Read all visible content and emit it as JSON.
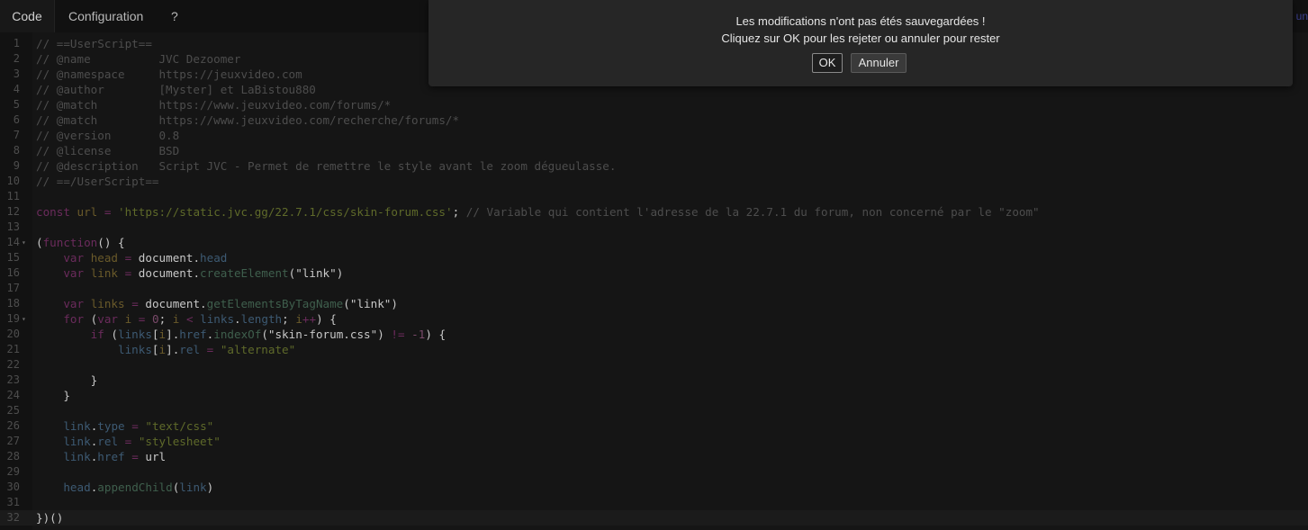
{
  "tabs": {
    "code": "Code",
    "configuration": "Configuration",
    "help": "?",
    "edge_fragment": "un"
  },
  "dialog": {
    "message_line1": "Les modifications n'ont pas étés sauvegardées !",
    "message_line2": "Cliquez sur OK pour les rejeter ou annuler pour rester",
    "ok_label": "OK",
    "cancel_label": "Annuler"
  },
  "editor": {
    "lines": [
      {
        "n": "1",
        "tokens": [
          [
            "cm",
            "// ==UserScript=="
          ]
        ]
      },
      {
        "n": "2",
        "tokens": [
          [
            "cm",
            "// @name          JVC Dezoomer"
          ]
        ]
      },
      {
        "n": "3",
        "tokens": [
          [
            "cm",
            "// @namespace     https://jeuxvideo.com"
          ]
        ]
      },
      {
        "n": "4",
        "tokens": [
          [
            "cm",
            "// @author        [Myster] et LaBistou880"
          ]
        ]
      },
      {
        "n": "5",
        "tokens": [
          [
            "cm",
            "// @match         https://www.jeuxvideo.com/forums/*"
          ]
        ]
      },
      {
        "n": "6",
        "tokens": [
          [
            "cm",
            "// @match         https://www.jeuxvideo.com/recherche/forums/*"
          ]
        ]
      },
      {
        "n": "7",
        "tokens": [
          [
            "cm",
            "// @version       0.8"
          ]
        ]
      },
      {
        "n": "8",
        "tokens": [
          [
            "cm",
            "// @license       BSD"
          ]
        ]
      },
      {
        "n": "9",
        "tokens": [
          [
            "cm",
            "// @description   Script JVC - Permet de remettre le style avant le zoom dégueulasse."
          ]
        ]
      },
      {
        "n": "10",
        "tokens": [
          [
            "cm",
            "// ==/UserScript=="
          ]
        ]
      },
      {
        "n": "11",
        "tokens": []
      },
      {
        "n": "12",
        "tokens": [
          [
            "kw",
            "const"
          ],
          [
            "plain",
            " "
          ],
          [
            "var",
            "url"
          ],
          [
            "plain",
            " "
          ],
          [
            "kw",
            "="
          ],
          [
            "plain",
            " "
          ],
          [
            "str",
            "'https://static.jvc.gg/22.7.1/css/skin-forum.css'"
          ],
          [
            "plain",
            "; "
          ],
          [
            "cm",
            "// Variable qui contient l'adresse de la 22.7.1 du forum, non concerné par le \"zoom\""
          ]
        ]
      },
      {
        "n": "13",
        "tokens": []
      },
      {
        "n": "14",
        "fold": true,
        "tokens": [
          [
            "plain",
            "("
          ],
          [
            "kw",
            "function"
          ],
          [
            "plain",
            "() {"
          ]
        ]
      },
      {
        "n": "15",
        "tokens": [
          [
            "plain",
            "    "
          ],
          [
            "kw",
            "var"
          ],
          [
            "plain",
            " "
          ],
          [
            "var",
            "head"
          ],
          [
            "plain",
            " "
          ],
          [
            "kw",
            "="
          ],
          [
            "plain",
            " document."
          ],
          [
            "prop",
            "head"
          ]
        ]
      },
      {
        "n": "16",
        "tokens": [
          [
            "plain",
            "    "
          ],
          [
            "kw",
            "var"
          ],
          [
            "plain",
            " "
          ],
          [
            "var",
            "link"
          ],
          [
            "plain",
            " "
          ],
          [
            "kw",
            "="
          ],
          [
            "plain",
            " document."
          ],
          [
            "fn",
            "createElement"
          ],
          [
            "plain",
            "(\"link\")"
          ]
        ]
      },
      {
        "n": "17",
        "tokens": []
      },
      {
        "n": "18",
        "tokens": [
          [
            "plain",
            "    "
          ],
          [
            "kw",
            "var"
          ],
          [
            "plain",
            " "
          ],
          [
            "var",
            "links"
          ],
          [
            "plain",
            " "
          ],
          [
            "kw",
            "="
          ],
          [
            "plain",
            " document."
          ],
          [
            "fn",
            "getElementsByTagName"
          ],
          [
            "plain",
            "(\"link\")"
          ]
        ]
      },
      {
        "n": "19",
        "fold": true,
        "tokens": [
          [
            "plain",
            "    "
          ],
          [
            "kw",
            "for"
          ],
          [
            "plain",
            " ("
          ],
          [
            "kw",
            "var"
          ],
          [
            "plain",
            " "
          ],
          [
            "var",
            "i"
          ],
          [
            "plain",
            " "
          ],
          [
            "kw",
            "="
          ],
          [
            "plain",
            " "
          ],
          [
            "num",
            "0"
          ],
          [
            "plain",
            "; "
          ],
          [
            "var",
            "i"
          ],
          [
            "plain",
            " "
          ],
          [
            "kw",
            "<"
          ],
          [
            "plain",
            " "
          ],
          [
            "prop",
            "links"
          ],
          [
            "plain",
            "."
          ],
          [
            "prop",
            "length"
          ],
          [
            "plain",
            "; "
          ],
          [
            "var",
            "i"
          ],
          [
            "kw",
            "++"
          ],
          [
            "plain",
            ") {"
          ]
        ]
      },
      {
        "n": "20",
        "tokens": [
          [
            "plain",
            "        "
          ],
          [
            "kw",
            "if"
          ],
          [
            "plain",
            " ("
          ],
          [
            "prop",
            "links"
          ],
          [
            "plain",
            "["
          ],
          [
            "var",
            "i"
          ],
          [
            "plain",
            "]."
          ],
          [
            "prop",
            "href"
          ],
          [
            "plain",
            "."
          ],
          [
            "fn",
            "indexOf"
          ],
          [
            "plain",
            "(\"skin-forum.css\") "
          ],
          [
            "kw",
            "!="
          ],
          [
            "plain",
            " "
          ],
          [
            "num",
            "-1"
          ],
          [
            "plain",
            ") {"
          ]
        ]
      },
      {
        "n": "21",
        "tokens": [
          [
            "plain",
            "            "
          ],
          [
            "prop",
            "links"
          ],
          [
            "plain",
            "["
          ],
          [
            "var",
            "i"
          ],
          [
            "plain",
            "]."
          ],
          [
            "prop",
            "rel"
          ],
          [
            "plain",
            " "
          ],
          [
            "kw",
            "="
          ],
          [
            "plain",
            " "
          ],
          [
            "str",
            "\"alternate\""
          ]
        ]
      },
      {
        "n": "22",
        "tokens": []
      },
      {
        "n": "23",
        "tokens": [
          [
            "plain",
            "        }"
          ]
        ]
      },
      {
        "n": "24",
        "tokens": [
          [
            "plain",
            "    }"
          ]
        ]
      },
      {
        "n": "25",
        "tokens": []
      },
      {
        "n": "26",
        "tokens": [
          [
            "plain",
            "    "
          ],
          [
            "prop",
            "link"
          ],
          [
            "plain",
            "."
          ],
          [
            "prop",
            "type"
          ],
          [
            "plain",
            " "
          ],
          [
            "kw",
            "="
          ],
          [
            "plain",
            " "
          ],
          [
            "str",
            "\"text/css\""
          ]
        ]
      },
      {
        "n": "27",
        "tokens": [
          [
            "plain",
            "    "
          ],
          [
            "prop",
            "link"
          ],
          [
            "plain",
            "."
          ],
          [
            "prop",
            "rel"
          ],
          [
            "plain",
            " "
          ],
          [
            "kw",
            "="
          ],
          [
            "plain",
            " "
          ],
          [
            "str",
            "\"stylesheet\""
          ]
        ]
      },
      {
        "n": "28",
        "tokens": [
          [
            "plain",
            "    "
          ],
          [
            "prop",
            "link"
          ],
          [
            "plain",
            "."
          ],
          [
            "prop",
            "href"
          ],
          [
            "plain",
            " "
          ],
          [
            "kw",
            "="
          ],
          [
            "plain",
            " url"
          ]
        ]
      },
      {
        "n": "29",
        "tokens": []
      },
      {
        "n": "30",
        "tokens": [
          [
            "plain",
            "    "
          ],
          [
            "prop",
            "head"
          ],
          [
            "plain",
            "."
          ],
          [
            "fn",
            "appendChild"
          ],
          [
            "plain",
            "("
          ],
          [
            "prop",
            "link"
          ],
          [
            "plain",
            ")"
          ]
        ]
      },
      {
        "n": "31",
        "tokens": []
      },
      {
        "n": "32",
        "active": true,
        "tokens": [
          [
            "plain",
            "})()"
          ]
        ]
      }
    ]
  }
}
